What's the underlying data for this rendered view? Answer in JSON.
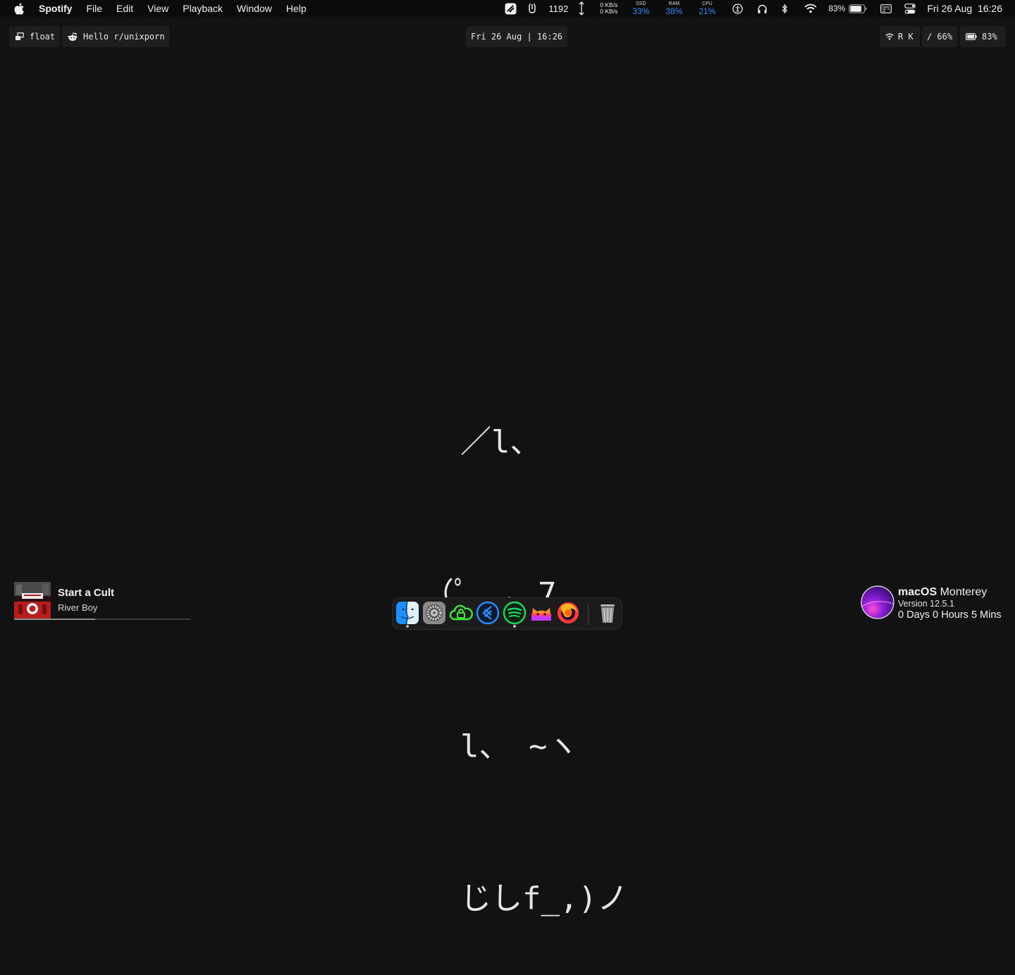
{
  "menubar": {
    "app_name": "Spotify",
    "items": [
      "File",
      "Edit",
      "View",
      "Playback",
      "Window",
      "Help"
    ],
    "counter": "1192",
    "network": {
      "up": "0 KB/s",
      "down": "0 KB/s"
    },
    "stats": [
      {
        "label": "SSD",
        "value": "33%"
      },
      {
        "label": "RAM",
        "value": "38%"
      },
      {
        "label": "CPU",
        "value": "21%"
      }
    ],
    "battery_percent": "83%",
    "battery_level": 0.83,
    "datetime": "Fri 26 Aug  16:26",
    "accent": "#2b8cff"
  },
  "topbar": {
    "layout_label": "float",
    "window_title": "Hello r/unixporn",
    "clock": "Fri 26 Aug | 16:26",
    "wifi_label": "R K",
    "disk_label": "/ 66%",
    "battery_label": "83%"
  },
  "ascii_art": [
    "  ／l、",
    "（ﾟ､ ｡ 7",
    "  l、 ~ヽ",
    "  じしf_,)ノ"
  ],
  "now_playing": {
    "title": "Start a Cult",
    "artist": "River Boy",
    "progress": 0.46
  },
  "dock": {
    "apps": [
      "finder-icon",
      "system-preferences-icon",
      "cloud-lock-icon",
      "vscode-icon",
      "spotify-icon",
      "cat-app-icon",
      "firefox-icon",
      "trash-icon"
    ],
    "running": [
      "finder-icon",
      "spotify-icon"
    ]
  },
  "sysinfo": {
    "os_name_bold": "macOS",
    "os_name_rest": "Monterey",
    "version": "Version 12.5.1",
    "uptime": "0 Days 0 Hours 5 Mins"
  }
}
